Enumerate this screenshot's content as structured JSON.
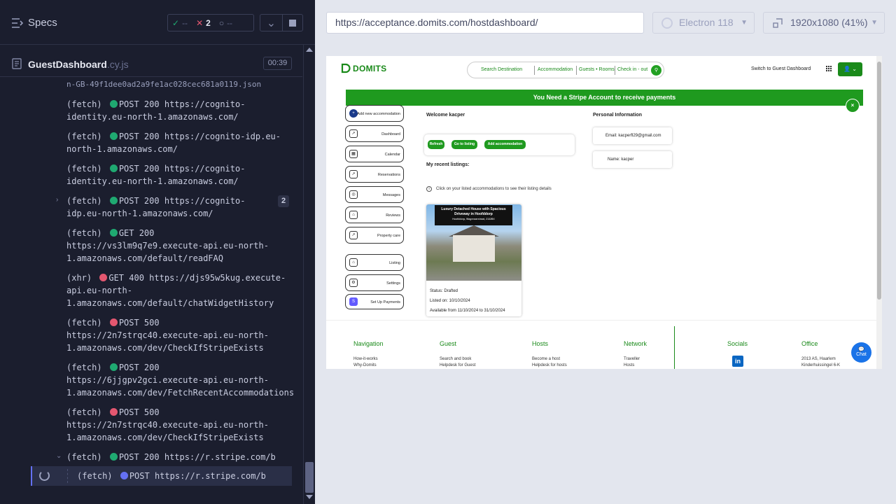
{
  "reporter": {
    "title": "Specs",
    "stats": {
      "passed": "--",
      "failed": "2",
      "pending": "--"
    },
    "file": {
      "name": "GuestDashboard",
      "ext": ".cy.js",
      "time": "00:39"
    },
    "log_partial": "n-GB-49f1dee0ad2a9fe1ac028cec681a0119.json",
    "logs": [
      {
        "prefix": "(fetch)",
        "status": "green",
        "method": "POST 200",
        "url_first": "https://cognito-",
        "url_rest": [
          "identity.eu-north-1.amazonaws.com/"
        ]
      },
      {
        "prefix": "(fetch)",
        "status": "green",
        "method": "POST 200",
        "url_first": "https://cognito-idp.eu-",
        "url_rest": [
          "north-1.amazonaws.com/"
        ]
      },
      {
        "prefix": "(fetch)",
        "status": "green",
        "method": "POST 200",
        "url_first": "https://cognito-",
        "url_rest": [
          "identity.eu-north-1.amazonaws.com/"
        ]
      },
      {
        "prefix": "(fetch)",
        "status": "green",
        "method": "POST 200",
        "url_first": "https://cognito-",
        "url_rest": [
          "idp.eu-north-1.amazonaws.com/"
        ]
      },
      {
        "prefix": "(fetch)",
        "status": "green",
        "method": "GET 200",
        "url_first": "",
        "url_rest": [
          "https://vs3lm9q7e9.execute-api.eu-north-",
          "1.amazonaws.com/default/readFAQ"
        ]
      },
      {
        "prefix": "(xhr)",
        "status": "red",
        "method": "GET 400",
        "url_first": "https://djs95w5kug.execute-",
        "url_rest": [
          "api.eu-north-",
          "1.amazonaws.com/default/chatWidgetHistory"
        ]
      },
      {
        "prefix": "(fetch)",
        "status": "red",
        "method": "POST 500",
        "url_first": "",
        "url_rest": [
          "https://2n7strqc40.execute-api.eu-north-",
          "1.amazonaws.com/dev/CheckIfStripeExists"
        ]
      },
      {
        "prefix": "(fetch)",
        "status": "green",
        "method": "POST 200",
        "url_first": "",
        "url_rest": [
          "https://6jjgpv2gci.execute-api.eu-north-",
          "1.amazonaws.com/dev/FetchRecentAccommodations"
        ]
      },
      {
        "prefix": "(fetch)",
        "status": "red",
        "method": "POST 500",
        "url_first": "",
        "url_rest": [
          "https://2n7strqc40.execute-api.eu-north-",
          "1.amazonaws.com/dev/CheckIfStripeExists"
        ]
      },
      {
        "prefix": "(fetch)",
        "status": "green",
        "method": "POST 200",
        "url_first": "https://r.stripe.com/b",
        "url_rest": []
      }
    ],
    "badge_count": "2",
    "active": {
      "prefix": "(fetch)",
      "status": "blue",
      "method": "POST",
      "url": "https://r.stripe.com/b"
    }
  },
  "browser": {
    "url": "https://acceptance.domits.com/hostdashboard/",
    "engine": "Electron 118",
    "viewport": "1920x1080",
    "zoom": "(41%)"
  },
  "site": {
    "logo": "DOMITS",
    "search": {
      "destination": "Search Destination",
      "accommodation": "Accommodation",
      "guests": "Guests • Rooms",
      "dates": "Check in - out"
    },
    "switch_label": "Switch to Guest Dashboard",
    "banner": "You Need a Stripe Account to receive payments",
    "banner_close": "×",
    "sidebar": [
      {
        "label": "Add new accommodation",
        "icon": "+"
      },
      {
        "label": "Dashboard",
        "icon": "📈"
      },
      {
        "label": "Calendar",
        "icon": "▦"
      },
      {
        "label": "Reservations",
        "icon": "📈"
      },
      {
        "label": "Messages",
        "icon": "💬"
      },
      {
        "label": "Reviews",
        "icon": "⌂"
      },
      {
        "label": "Property care",
        "icon": "📈"
      },
      {
        "label": "Listing",
        "icon": "⌂"
      },
      {
        "label": "Settings",
        "icon": "⚙"
      },
      {
        "label": "Set Up Payments",
        "icon": "S"
      }
    ],
    "welcome": "Welcome kacper",
    "actions": {
      "refresh": "Refresh",
      "go_listing": "Go to listing",
      "add": "Add accommodation"
    },
    "recent_title": "My recent listings:",
    "info": "Click on your listed accommodations to see their listing details",
    "listing": {
      "title": "Luxury Detached House with Spacious Driveway in Hoofddorp",
      "address": "Hoofddorp, Wagenaarstraat, 2132BX",
      "status": "Status: Drafted",
      "listed": "Listed on: 10/10/2024",
      "available": "Available from 11/10/2024 to 31/10/2024"
    },
    "personal": {
      "title": "Personal Information",
      "email": "Email: kacperfl29@gmail.com",
      "name": "Name: kacper"
    },
    "footer": {
      "navigation": {
        "head": "Navigation",
        "links": [
          "How-it-works",
          "Why-Domits"
        ]
      },
      "guest": {
        "head": "Guest",
        "links": [
          "Search and book",
          "Helpdesk for Guest"
        ]
      },
      "hosts": {
        "head": "Hosts",
        "links": [
          "Become a host",
          "Helpdesk for hosts"
        ]
      },
      "network": {
        "head": "Network",
        "links": [
          "Traveller",
          "Hosts"
        ]
      },
      "socials": {
        "head": "Socials",
        "icon": "in"
      },
      "office": {
        "head": "Office",
        "links": [
          "2013 AS, Haarlem",
          "Kinderhuissingel 6-K"
        ]
      }
    },
    "chat_label": "Chat",
    "colors": {
      "brand_green": "#1a8a1a",
      "banner_green": "#1f9a1f",
      "reporter_bg": "#1b1e2e"
    }
  }
}
